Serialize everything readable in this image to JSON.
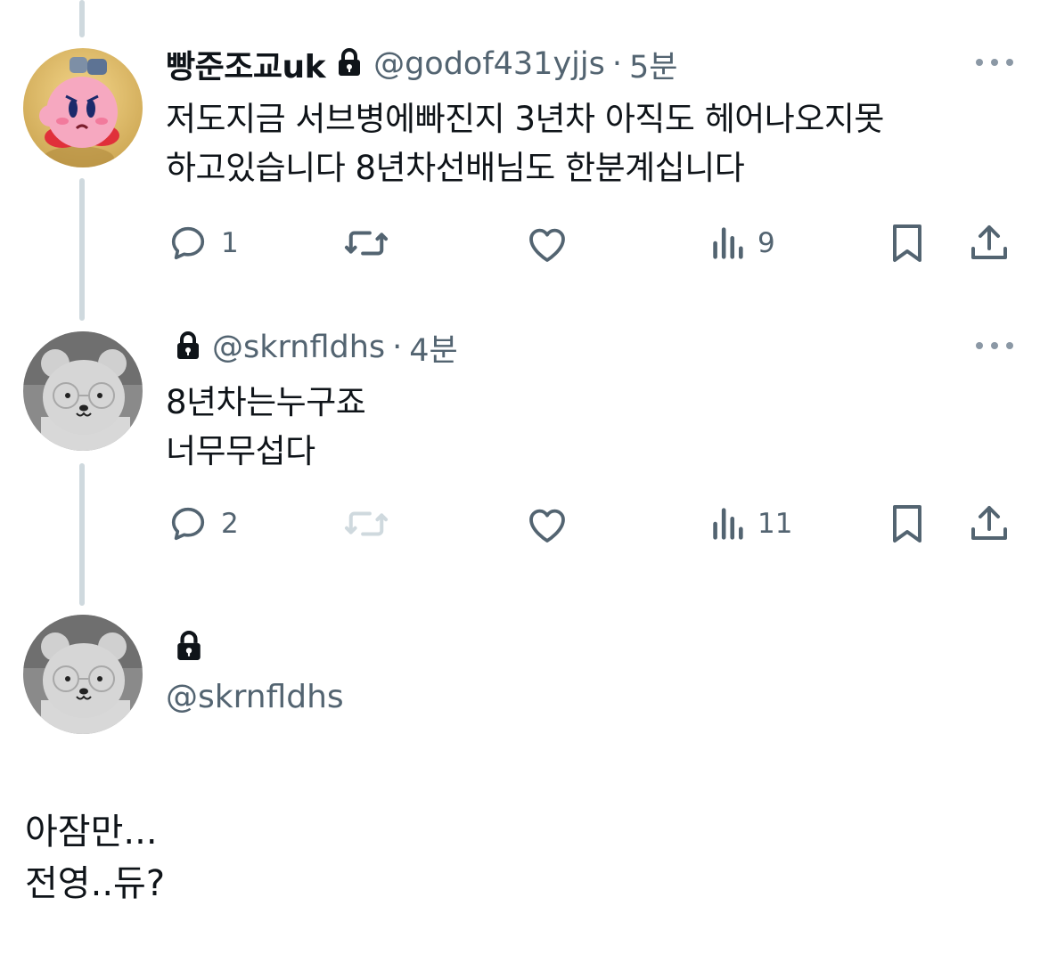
{
  "replies": [
    {
      "display_name": "빵준조교uk",
      "handle": "@godof431yjjs",
      "separator": "·",
      "time": "5분",
      "text_lines": [
        "저도지금 서브병에빠진지 3년차 아직도 헤어나오지못",
        "하고있습니다 8년차선배님도 한분계십니다"
      ],
      "reply_count": "1",
      "views": "9"
    },
    {
      "handle": "@skrnfldhs",
      "separator": "·",
      "time": "4분",
      "text_lines": [
        "8년차는누구죠",
        "너무무섭다"
      ],
      "reply_count": "2",
      "views": "11"
    }
  ],
  "current_post": {
    "handle": "@skrnfldhs",
    "text_lines": [
      "아잠만...",
      "전영..듀?"
    ]
  },
  "icons": {
    "reply": "reply-icon",
    "repost": "repost-icon",
    "like": "heart-icon",
    "views": "views-icon",
    "bookmark": "bookmark-icon",
    "share": "share-icon",
    "lock": "lock-icon",
    "more": "more-icon"
  },
  "colors": {
    "text": "#0f1419",
    "secondary": "#536471",
    "thread_line": "#cfd9de",
    "disabled": "#cfd9de"
  }
}
